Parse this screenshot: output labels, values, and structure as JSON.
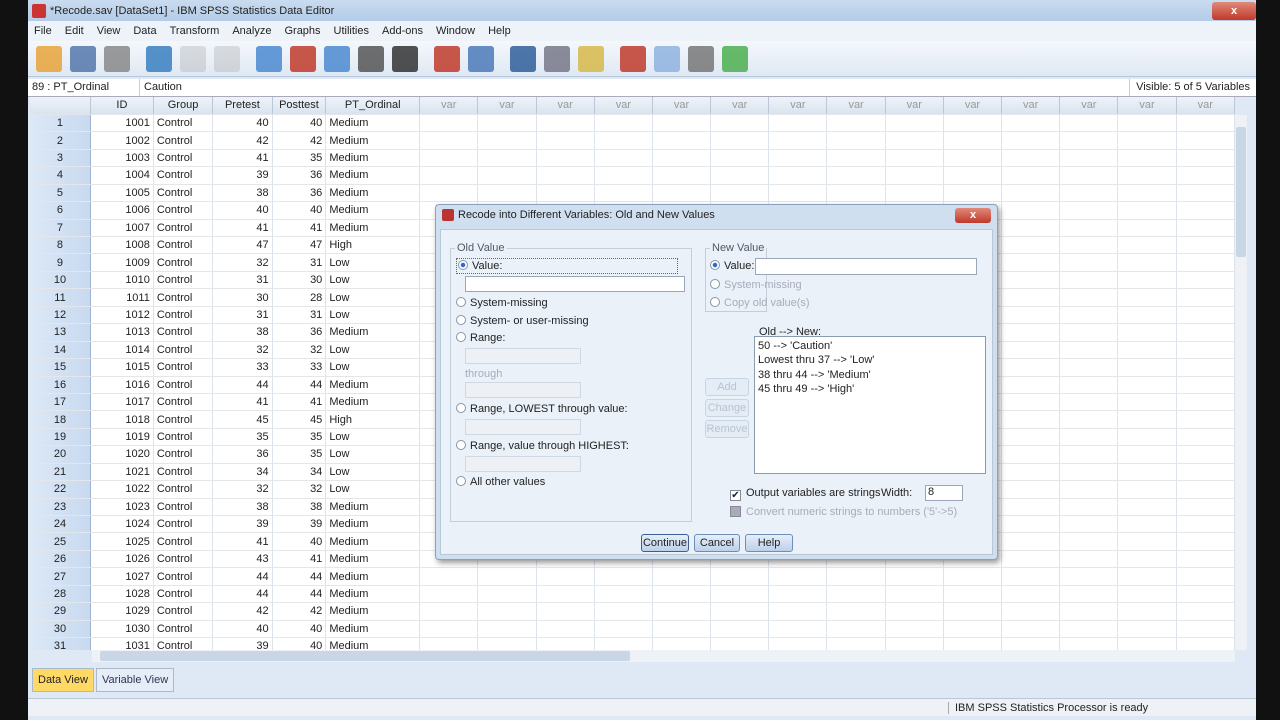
{
  "window": {
    "title": "*Recode.sav [DataSet1] - IBM SPSS Statistics Data Editor",
    "close": "x"
  },
  "menu": [
    "File",
    "Edit",
    "View",
    "Data",
    "Transform",
    "Analyze",
    "Graphs",
    "Utilities",
    "Add-ons",
    "Window",
    "Help"
  ],
  "toolbar_icons": [
    "open-icon",
    "save-icon",
    "print-icon",
    "dialog-recall-icon",
    "undo-icon",
    "redo-icon",
    "goto-case-icon",
    "goto-variable-icon",
    "variables-icon",
    "run-descriptives-icon",
    "find-icon",
    "insert-cases-icon",
    "insert-variable-icon",
    "split-file-icon",
    "weight-cases-icon",
    "select-cases-icon",
    "value-labels-icon",
    "use-sets-icon",
    "show-all-variables-icon",
    "spell-check-icon"
  ],
  "cell_editor": {
    "ref": "89 : PT_Ordinal",
    "value": "Caution",
    "visible": "Visible: 5 of 5 Variables"
  },
  "columns": [
    "ID",
    "Group",
    "Pretest",
    "Posttest",
    "PT_Ordinal"
  ],
  "empty_col_label": "var",
  "rows": [
    [
      "1",
      "1001",
      "Control",
      "40",
      "40",
      "Medium"
    ],
    [
      "2",
      "1002",
      "Control",
      "42",
      "42",
      "Medium"
    ],
    [
      "3",
      "1003",
      "Control",
      "41",
      "35",
      "Medium"
    ],
    [
      "4",
      "1004",
      "Control",
      "39",
      "36",
      "Medium"
    ],
    [
      "5",
      "1005",
      "Control",
      "38",
      "36",
      "Medium"
    ],
    [
      "6",
      "1006",
      "Control",
      "40",
      "40",
      "Medium"
    ],
    [
      "7",
      "1007",
      "Control",
      "41",
      "41",
      "Medium"
    ],
    [
      "8",
      "1008",
      "Control",
      "47",
      "47",
      "High"
    ],
    [
      "9",
      "1009",
      "Control",
      "32",
      "31",
      "Low"
    ],
    [
      "10",
      "1010",
      "Control",
      "31",
      "30",
      "Low"
    ],
    [
      "11",
      "1011",
      "Control",
      "30",
      "28",
      "Low"
    ],
    [
      "12",
      "1012",
      "Control",
      "31",
      "31",
      "Low"
    ],
    [
      "13",
      "1013",
      "Control",
      "38",
      "36",
      "Medium"
    ],
    [
      "14",
      "1014",
      "Control",
      "32",
      "32",
      "Low"
    ],
    [
      "15",
      "1015",
      "Control",
      "33",
      "33",
      "Low"
    ],
    [
      "16",
      "1016",
      "Control",
      "44",
      "44",
      "Medium"
    ],
    [
      "17",
      "1017",
      "Control",
      "41",
      "41",
      "Medium"
    ],
    [
      "18",
      "1018",
      "Control",
      "45",
      "45",
      "High"
    ],
    [
      "19",
      "1019",
      "Control",
      "35",
      "35",
      "Low"
    ],
    [
      "20",
      "1020",
      "Control",
      "36",
      "35",
      "Low"
    ],
    [
      "21",
      "1021",
      "Control",
      "34",
      "34",
      "Low"
    ],
    [
      "22",
      "1022",
      "Control",
      "32",
      "32",
      "Low"
    ],
    [
      "23",
      "1023",
      "Control",
      "38",
      "38",
      "Medium"
    ],
    [
      "24",
      "1024",
      "Control",
      "39",
      "39",
      "Medium"
    ],
    [
      "25",
      "1025",
      "Control",
      "41",
      "40",
      "Medium"
    ],
    [
      "26",
      "1026",
      "Control",
      "43",
      "41",
      "Medium"
    ],
    [
      "27",
      "1027",
      "Control",
      "44",
      "44",
      "Medium"
    ],
    [
      "28",
      "1028",
      "Control",
      "44",
      "44",
      "Medium"
    ],
    [
      "29",
      "1029",
      "Control",
      "42",
      "42",
      "Medium"
    ],
    [
      "30",
      "1030",
      "Control",
      "40",
      "40",
      "Medium"
    ],
    [
      "31",
      "1031",
      "Control",
      "39",
      "40",
      "Medium"
    ]
  ],
  "tabs": {
    "data_view": "Data View",
    "variable_view": "Variable View"
  },
  "status": "IBM SPSS Statistics Processor is ready",
  "dialog": {
    "title": "Recode into Different Variables: Old and New Values",
    "old_value": {
      "legend": "Old Value",
      "value": "Value:",
      "value_input": "",
      "system_missing": "System-missing",
      "sys_user_missing": "System- or user-missing",
      "range": "Range:",
      "through": "through",
      "range_lowest": "Range, LOWEST through value:",
      "range_highest": "Range, value through HIGHEST:",
      "all_other": "All other values"
    },
    "new_value": {
      "legend": "New Value",
      "value": "Value:",
      "value_input": "",
      "system_missing": "System-missing",
      "copy_old": "Copy old value(s)"
    },
    "list_label": "Old --> New:",
    "list": [
      "50 --> 'Caution'",
      "Lowest thru 37 --> 'Low'",
      "38 thru 44 --> 'Medium'",
      "45 thru 49 --> 'High'"
    ],
    "add": "Add",
    "change": "Change",
    "remove": "Remove",
    "output_strings": "Output variables are strings",
    "output_strings_checked": true,
    "width_label": "Width:",
    "width_value": "8",
    "convert": "Convert numeric strings to numbers ('5'->5)",
    "convert_checked": false,
    "continue": "Continue",
    "cancel": "Cancel",
    "help": "Help"
  }
}
